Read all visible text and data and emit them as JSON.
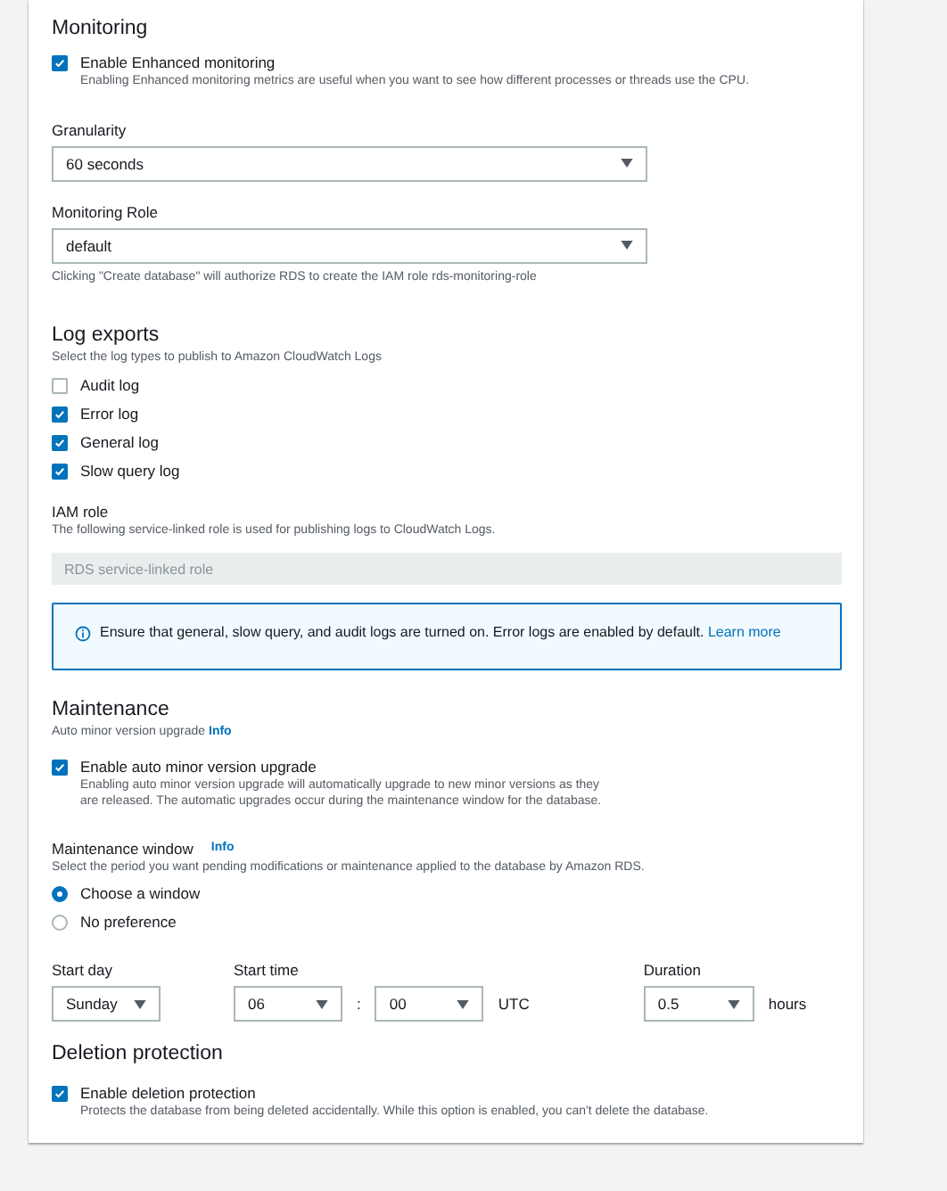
{
  "monitoring": {
    "title": "Monitoring",
    "enhanced": {
      "label": "Enable Enhanced monitoring",
      "checked": true,
      "description": "Enabling Enhanced monitoring metrics are useful when you want to see how different processes or threads use the CPU."
    },
    "granularity": {
      "label": "Granularity",
      "value": "60 seconds"
    },
    "role": {
      "label": "Monitoring Role",
      "value": "default",
      "note": "Clicking \"Create database\" will authorize RDS to create the IAM role rds-monitoring-role"
    }
  },
  "log_exports": {
    "title": "Log exports",
    "description": "Select the log types to publish to Amazon CloudWatch Logs",
    "options": [
      {
        "label": "Audit log",
        "checked": false
      },
      {
        "label": "Error log",
        "checked": true
      },
      {
        "label": "General log",
        "checked": true
      },
      {
        "label": "Slow query log",
        "checked": true
      }
    ],
    "iam_role": {
      "label": "IAM role",
      "description": "The following service-linked role is used for publishing logs to CloudWatch Logs.",
      "placeholder": "RDS service-linked role"
    },
    "info": {
      "text": "Ensure that general, slow query, and audit logs are turned on. Error logs are enabled by default.",
      "link": "Learn more"
    }
  },
  "maintenance": {
    "title": "Maintenance",
    "subtitle": "Auto minor version upgrade",
    "subtitle_info": "Info",
    "auto_upgrade": {
      "label": "Enable auto minor version upgrade",
      "checked": true,
      "description": "Enabling auto minor version upgrade will automatically upgrade to new minor versions as they are released. The automatic upgrades occur during the maintenance window for the database."
    },
    "window": {
      "label": "Maintenance window",
      "info": "Info",
      "description": "Select the period you want pending modifications or maintenance applied to the database by Amazon RDS.",
      "options": [
        {
          "label": "Choose a window",
          "selected": true
        },
        {
          "label": "No preference",
          "selected": false
        }
      ]
    },
    "start_day": {
      "label": "Start day",
      "value": "Sunday"
    },
    "start_time": {
      "label": "Start time",
      "hour": "06",
      "separator": ":",
      "minute": "00",
      "zone": "UTC"
    },
    "duration": {
      "label": "Duration",
      "value": "0.5",
      "unit": "hours"
    }
  },
  "deletion": {
    "title": "Deletion protection",
    "option": {
      "label": "Enable deletion protection",
      "checked": true,
      "description": "Protects the database from being deleted accidentally. While this option is enabled, you can't delete the database."
    }
  }
}
